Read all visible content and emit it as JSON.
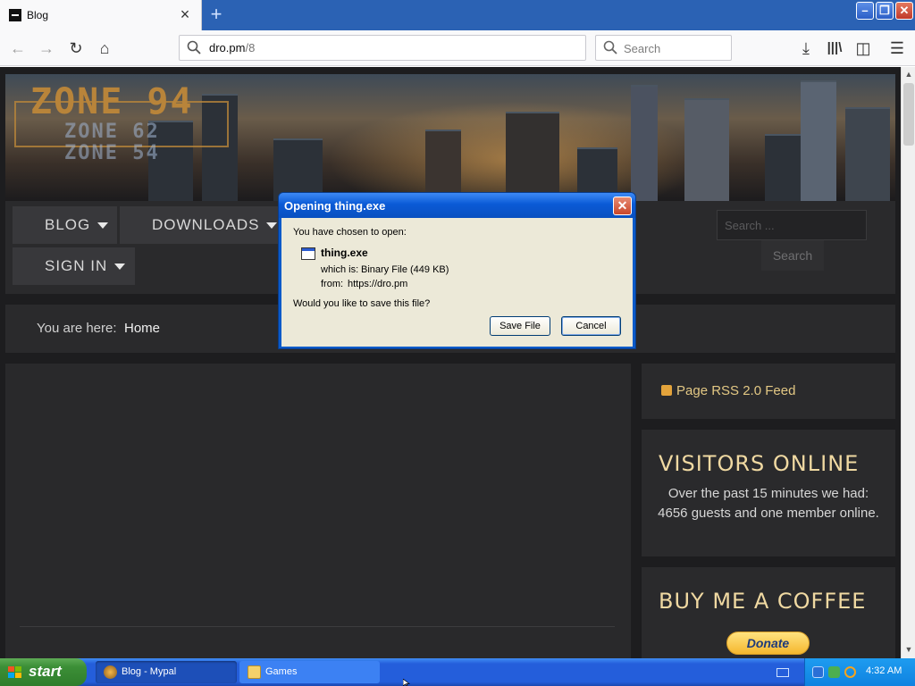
{
  "browser": {
    "tab_title": "Blog",
    "url_host": "dro.pm",
    "url_path": "/8",
    "search_placeholder": "Search"
  },
  "site": {
    "logo_main": "ZONE 94",
    "logo_sub1": "ZONE 62",
    "logo_sub2": "ZONE 54",
    "menu": {
      "blog": "BLOG",
      "downloads": "DOWNLOADS",
      "sign_in": "SIGN IN"
    },
    "search_placeholder": "Search ...",
    "search_button": "Search",
    "breadcrumb_label": "You are here:",
    "breadcrumb_current": "Home",
    "rss_link": "Page RSS 2.0 Feed",
    "visitors_title": "VISITORS ONLINE",
    "visitors_text": "Over the past 15 minutes we had: 4656 guests and one member online.",
    "coffee_title": "BUY ME A COFFEE",
    "donate_label": "Donate"
  },
  "dialog": {
    "title": "Opening thing.exe",
    "intro": "You have chosen to open:",
    "file_name": "thing.exe",
    "which_is_label": "which is:",
    "which_is_value": "Binary File (449 KB)",
    "from_label": "from:",
    "from_value": "https://dro.pm",
    "question": "Would you like to save this file?",
    "save_button": "Save File",
    "cancel_button": "Cancel"
  },
  "taskbar": {
    "start_label": "start",
    "tasks": [
      {
        "label": "Blog - Mypal"
      },
      {
        "label": "Games"
      }
    ],
    "clock": "4:32 AM"
  },
  "colors": {
    "accent_gold": "#f0d9a2",
    "link_gold": "#e3c884",
    "xp_blue": "#245edb",
    "start_green": "#3c8f37"
  }
}
